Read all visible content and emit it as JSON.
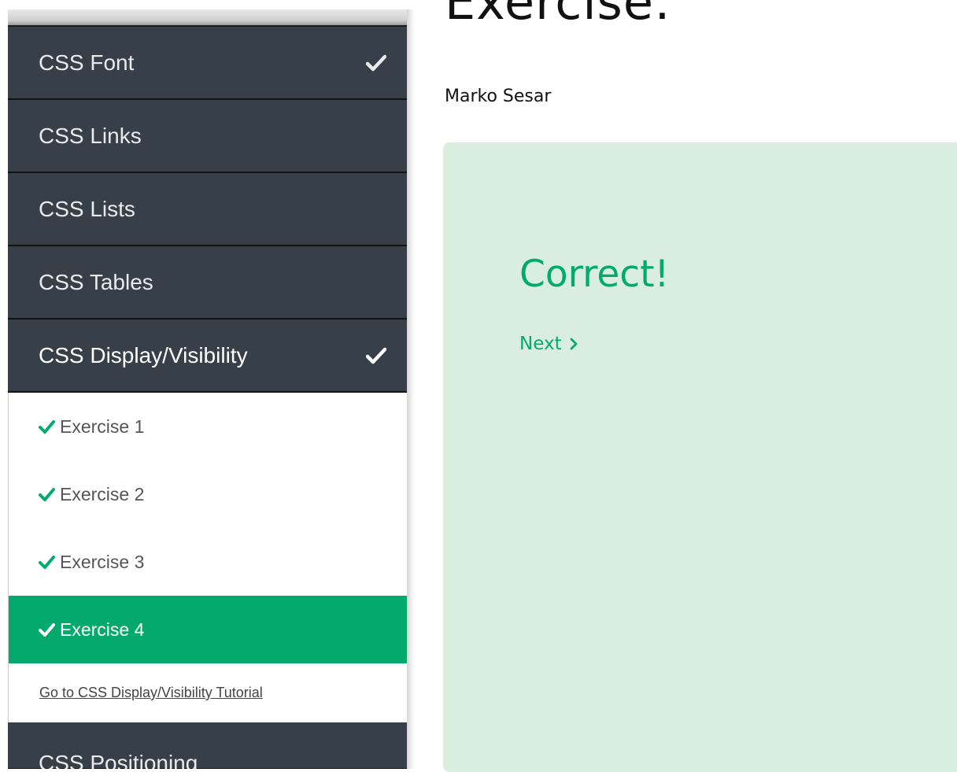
{
  "main": {
    "title": "Exercise:",
    "user_name": "Marko Sesar",
    "result": {
      "heading": "Correct!",
      "next_label": "Next"
    }
  },
  "sidebar": {
    "topics_before": [
      {
        "label": "CSS Font",
        "completed": true
      },
      {
        "label": "CSS Links",
        "completed": false
      },
      {
        "label": "CSS Lists",
        "completed": false
      },
      {
        "label": "CSS Tables",
        "completed": false
      }
    ],
    "active_topic": {
      "label": "CSS Display/Visibility",
      "completed": true
    },
    "exercises": [
      {
        "label": "Exercise 1",
        "completed": true
      },
      {
        "label": "Exercise 2",
        "completed": true
      },
      {
        "label": "Exercise 3",
        "completed": true
      },
      {
        "label": "Exercise 4",
        "completed": true,
        "active": true
      }
    ],
    "tutorial_link": "Go to CSS Display/Visibility Tutorial",
    "topic_after": "CSS Positioning"
  },
  "colors": {
    "sidebar_bg": "#374049",
    "accent_green": "#04aa6d",
    "result_panel_bg": "#d9eee1"
  },
  "icons": {
    "topic_check": "check-icon",
    "exercise_check": "check-icon",
    "next_arrow": "chevron-right-icon"
  }
}
